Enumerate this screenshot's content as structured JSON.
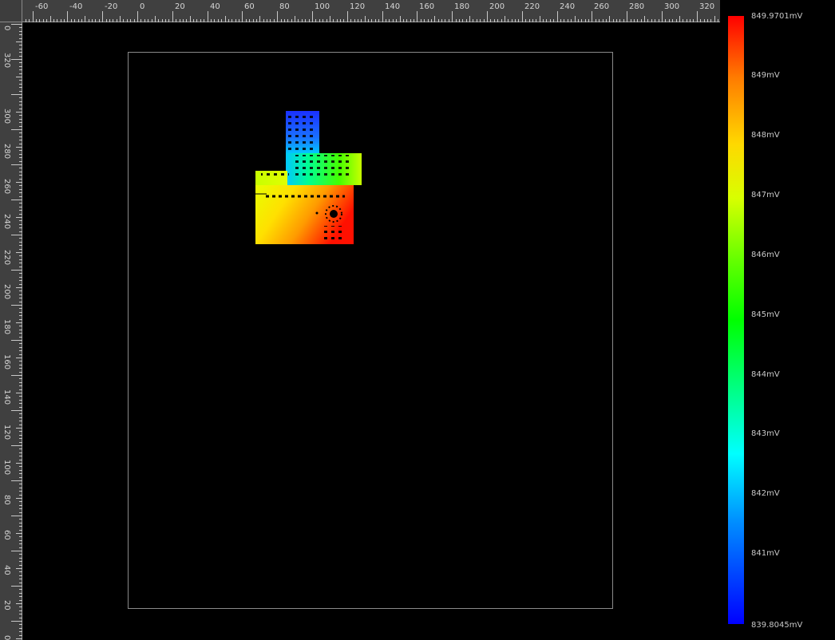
{
  "rulers": {
    "top_labels": [
      "-60",
      "-40",
      "-20",
      "0",
      "20",
      "40",
      "60",
      "80",
      "100",
      "120",
      "140",
      "160",
      "180",
      "200",
      "220",
      "240",
      "260",
      "280",
      "300",
      "320"
    ],
    "left_labels": [
      "0",
      "320",
      "300",
      "280",
      "260",
      "240",
      "220",
      "200",
      "180",
      "160",
      "140",
      "120",
      "100",
      "80",
      "60",
      "40",
      "20",
      "0"
    ]
  },
  "legend": {
    "max_label": "849.9701mV",
    "min_label": "839.8045mV",
    "ticks": [
      "849mV",
      "848mV",
      "847mV",
      "846mV",
      "845mV",
      "844mV",
      "843mV",
      "842mV",
      "841mV"
    ],
    "colors": [
      "#ff0000",
      "#ff7a00",
      "#ffd800",
      "#d8ff00",
      "#66ff00",
      "#00ff00",
      "#00ff80",
      "#00ffff",
      "#0090ff",
      "#0000ff"
    ]
  }
}
